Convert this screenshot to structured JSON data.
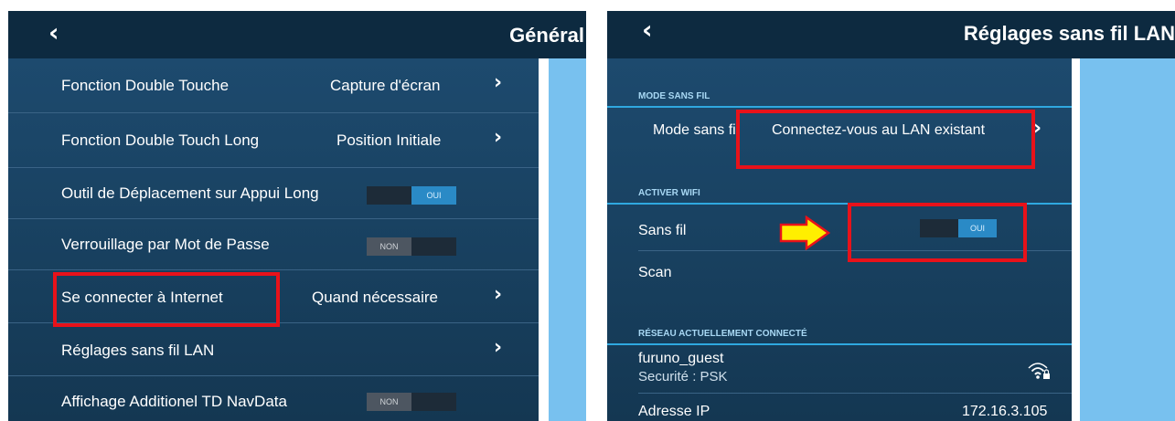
{
  "left": {
    "header": {
      "back_label": "‹",
      "title": "Général"
    },
    "rows": [
      {
        "label": "Fonction Double Touche",
        "value": "Capture d'écran"
      },
      {
        "label": "Fonction Double Touch Long",
        "value": "Position Initiale"
      },
      {
        "label": "Outil de Déplacement sur Appui Long",
        "toggle": "OUI"
      },
      {
        "label": "Verrouillage par Mot de Passe",
        "toggle": "NON"
      },
      {
        "label": "Se connecter à Internet",
        "value": "Quand nécessaire"
      },
      {
        "label": "Réglages sans fil LAN"
      },
      {
        "label": "Affichage Additionel TD NavData",
        "toggle": "NON"
      }
    ]
  },
  "right": {
    "header": {
      "back_label": "‹",
      "title": "Réglages sans fil LAN"
    },
    "sections": {
      "mode": "MODE SANS FIL",
      "wifi": "ACTIVER WIFI",
      "network": "RÉSEAU ACTUELLEMENT CONNECTÉ"
    },
    "mode_row": {
      "label": "Mode sans fil",
      "value": "Connectez-vous au LAN existant"
    },
    "wifi_row": {
      "label": "Sans fil",
      "toggle": "OUI"
    },
    "scan_row": {
      "label": "Scan"
    },
    "network_row": {
      "ssid": "furuno_guest",
      "security": "Securité : PSK"
    },
    "ip_row": {
      "label": "Adresse IP",
      "value": "172.16.3.105"
    }
  },
  "chevron": "›",
  "colors": {
    "header_bg": "#0d2a40",
    "list_bg": "#1d4a6e",
    "accent_blue": "#78c1ef",
    "toggle_on": "#2a8ac6",
    "highlight_red": "#e8121a",
    "arrow_yellow": "#ffef00"
  }
}
